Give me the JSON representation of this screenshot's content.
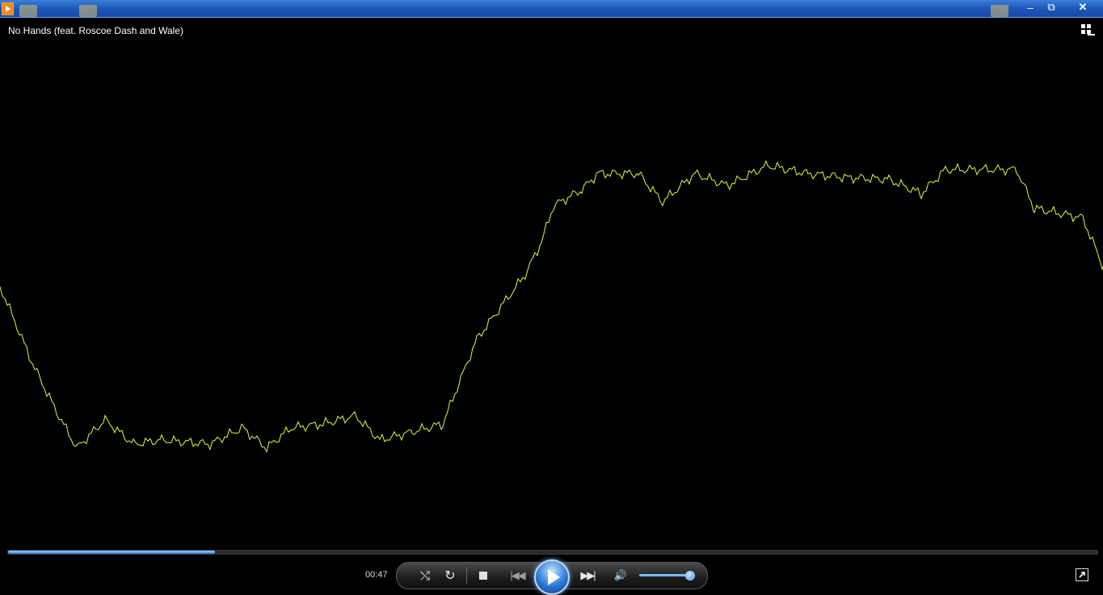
{
  "window": {
    "minimize_glyph": "–",
    "restore_glyph": "⧉",
    "close_glyph": "✕"
  },
  "now_playing": {
    "title": "No Hands (feat. Roscoe Dash and Wale)"
  },
  "transport": {
    "elapsed": "00:47",
    "seek_fraction": 0.19,
    "shuffle_glyph": "⤭",
    "repeat_glyph": "↻",
    "prev_glyph": "|◀◀",
    "next_glyph": "▶▶|",
    "mute_glyph": "🔊",
    "volume_fraction": 0.9
  },
  "visualization": {
    "color": "#d4ff3a"
  },
  "colors": {
    "titlebar": "#1a55b8",
    "accent": "#2f7fe0"
  }
}
